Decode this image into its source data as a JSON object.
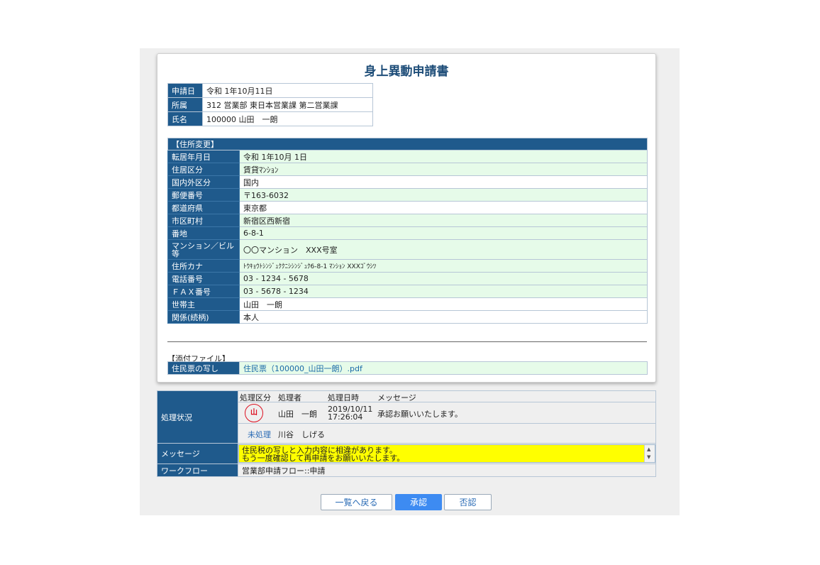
{
  "title": "身上異動申請書",
  "applicant": [
    {
      "label": "申請日",
      "value": "令和 1年10月11日"
    },
    {
      "label": "所属",
      "value": "312 営業部 東日本営業課 第二営業課"
    },
    {
      "label": "氏名",
      "value": "100000 山田　一朗"
    }
  ],
  "address": {
    "section_title": "【住所変更】",
    "rows": [
      {
        "label": "転居年月日",
        "value": "令和 1年10月 1日",
        "white": false
      },
      {
        "label": "住居区分",
        "value": "賃貸ﾏﾝｼｮﾝ",
        "white": false
      },
      {
        "label": "国内外区分",
        "value": "国内",
        "white": true
      },
      {
        "label": "郵便番号",
        "value": "〒163-6032",
        "white": false
      },
      {
        "label": "都道府県",
        "value": "東京都",
        "white": true
      },
      {
        "label": "市区町村",
        "value": "新宿区西新宿",
        "white": false
      },
      {
        "label": "番地",
        "value": "6-8-1",
        "white": false
      },
      {
        "label": "マンション／ビル等",
        "value": "〇〇マンション　XXX号室",
        "white": false
      },
      {
        "label": "住所カナ",
        "value": "ﾄｳｷｮｳﾄｼﾝｼﾞｭｸｸﾆｼｼﾝｼﾞｭｸ6-8-1 ﾏﾝｼｮﾝ XXXｺﾞｳｼﾂ",
        "white": false
      },
      {
        "label": "電話番号",
        "value": "03 - 1234 - 5678",
        "white": false
      },
      {
        "label": "ＦＡＸ番号",
        "value": "03 - 5678 - 1234",
        "white": false
      },
      {
        "label": "世帯主",
        "value": "山田　一朗",
        "white": true
      },
      {
        "label": "関係(続柄)",
        "value": "本人",
        "white": true
      }
    ]
  },
  "attachments": {
    "section_title": "【添付ファイル】",
    "label": "住民票の写し",
    "file": "住民票（100000_山田一朗）.pdf"
  },
  "status": {
    "label": "処理状況",
    "columns": [
      "処理区分",
      "処理者",
      "処理日時",
      "メッセージ"
    ],
    "stamp_char": "山",
    "processed": {
      "name": "山田　一朗",
      "date": "2019/10/11",
      "time": "17:26:04",
      "message": "承認お願いいたします。"
    },
    "pending": {
      "status": "未処理",
      "name": "川谷　しげる"
    }
  },
  "message": {
    "label": "メッセージ",
    "line1": "住民税の写しと入力内容に相違があります。",
    "line2": "もう一度確認して再申請をお願いいたします。"
  },
  "workflow": {
    "label": "ワークフロー",
    "value": "営業部申請フロー::申請"
  },
  "buttons": {
    "back": "一覧へ戻る",
    "approve": "承認",
    "reject": "否認"
  },
  "colors": {
    "header": "#1f5a8c",
    "title": "#1f4e79",
    "value_bg": "#e6fbe9",
    "message_bg": "#ffff00",
    "primary": "#3d8bf2"
  }
}
